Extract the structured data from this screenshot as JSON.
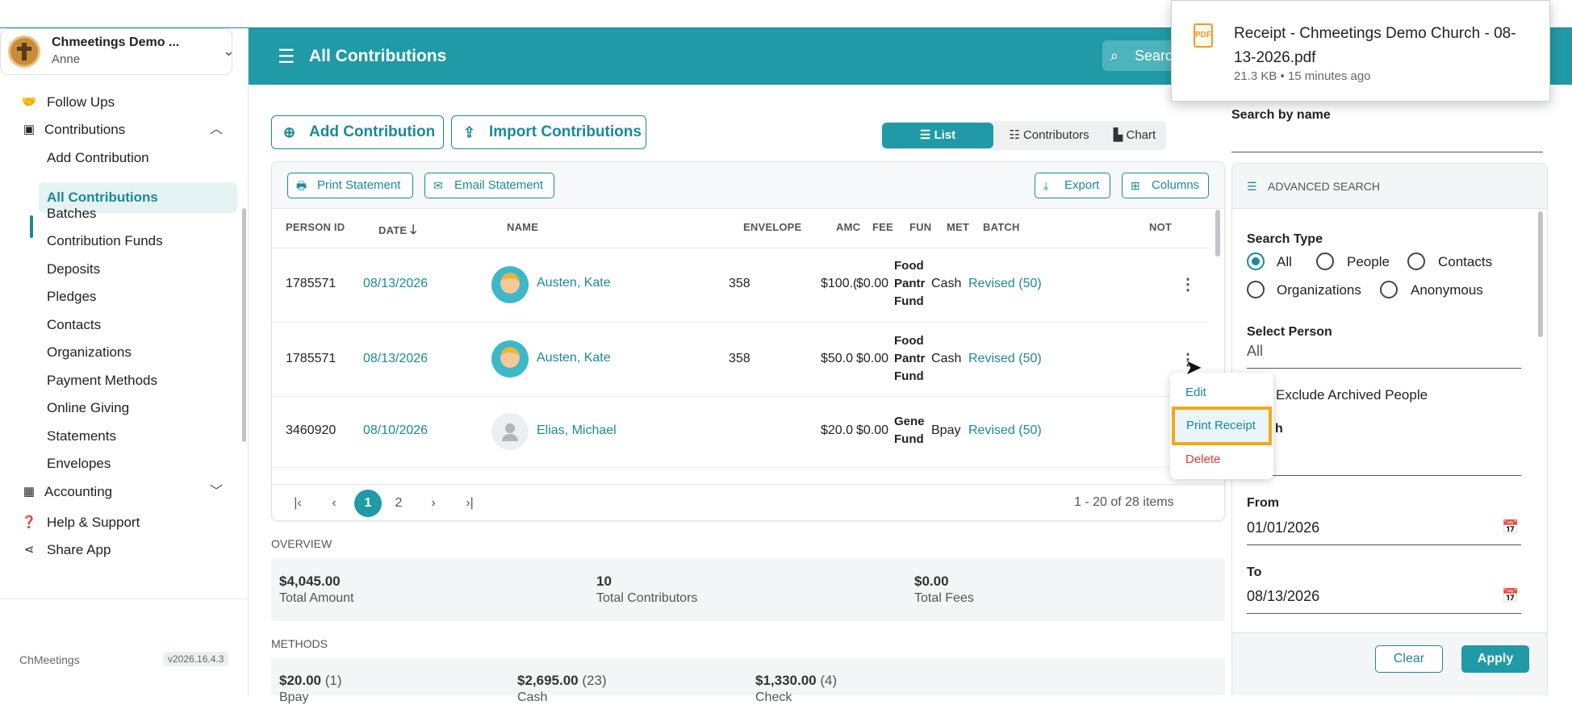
{
  "download": {
    "filename": "Receipt - Chmeetings Demo Church - 08-13-2026.pdf",
    "meta": "21.3 KB • 15 minutes ago"
  },
  "sidebar": {
    "church_name": "Chmeetings Demo ...",
    "user": "Anne",
    "items": [
      {
        "label": "Follow Ups",
        "icon": "handshake-icon"
      },
      {
        "label": "Contributions",
        "icon": "money-icon"
      },
      {
        "label": "Add Contribution"
      },
      {
        "label": "All Contributions"
      },
      {
        "label": "Batches"
      },
      {
        "label": "Contribution Funds"
      },
      {
        "label": "Deposits"
      },
      {
        "label": "Pledges"
      },
      {
        "label": "Contacts"
      },
      {
        "label": "Organizations"
      },
      {
        "label": "Payment Methods"
      },
      {
        "label": "Online Giving"
      },
      {
        "label": "Statements"
      },
      {
        "label": "Envelopes"
      },
      {
        "label": "Accounting",
        "icon": "grid-icon"
      }
    ],
    "help": "Help & Support",
    "share": "Share App",
    "brand": "ChMeetings",
    "version": "v2026.16.4.3"
  },
  "header": {
    "title": "All Contributions",
    "search_placeholder": "Searc"
  },
  "toolbar": {
    "add": "Add Contribution",
    "import": "Import Contributions",
    "views": [
      "List",
      "Contributors",
      "Chart"
    ],
    "print_statement": "Print Statement",
    "email_statement": "Email Statement",
    "export": "Export",
    "columns": "Columns"
  },
  "table": {
    "headers": [
      "PERSON ID",
      "DATE",
      "NAME",
      "ENVELOPE",
      "AMC",
      "FEE",
      "FUN",
      "MET",
      "BATCH",
      "NOT"
    ],
    "rows": [
      {
        "id": "1785571",
        "date": "08/13/2026",
        "name": "Austen, Kate",
        "envelope": "358",
        "amount": "$100.(",
        "fee": "$0.00",
        "fund1": "Food",
        "fund2": "Pantr",
        "fund3": "Fund",
        "method": "Cash",
        "batch": "Revised (50)"
      },
      {
        "id": "1785571",
        "date": "08/13/2026",
        "name": "Austen, Kate",
        "envelope": "358",
        "amount": "$50.0",
        "fee": "$0.00",
        "fund1": "Food",
        "fund2": "Pantr",
        "fund3": "Fund",
        "method": "Cash",
        "batch": "Revised (50)"
      },
      {
        "id": "3460920",
        "date": "08/10/2026",
        "name": "Elias, Michael",
        "envelope": "",
        "amount": "$20.0",
        "fee": "$0.00",
        "fund1": "Gene",
        "fund2": "Fund",
        "fund3": "",
        "method": "Bpay",
        "batch": "Revised (50)"
      }
    ]
  },
  "pager": {
    "pages": [
      "1",
      "2"
    ],
    "info": "1 - 20 of 28 items"
  },
  "row_menu": {
    "edit": "Edit",
    "print": "Print Receipt",
    "delete": "Delete"
  },
  "overview": {
    "label": "OVERVIEW",
    "stats": [
      {
        "value": "$4,045.00",
        "label": "Total Amount"
      },
      {
        "value": "10",
        "label": "Total Contributors"
      },
      {
        "value": "$0.00",
        "label": "Total Fees"
      }
    ]
  },
  "methods": {
    "label": "METHODS",
    "items": [
      {
        "value": "$20.00",
        "count": "(1)",
        "label": "Bpay"
      },
      {
        "value": "$2,695.00",
        "count": "(23)",
        "label": "Cash"
      },
      {
        "value": "$1,330.00",
        "count": "(4)",
        "label": "Check"
      }
    ]
  },
  "right_panel": {
    "search_label": "Search by name",
    "advanced": "ADVANCED SEARCH",
    "search_type_label": "Search Type",
    "types": [
      "All",
      "People",
      "Contacts",
      "Organizations",
      "Anonymous"
    ],
    "selected_type": "All",
    "select_person_label": "Select Person",
    "select_person_value": "All",
    "exclude_archived": "Exclude Archived People",
    "hidden_label": "h",
    "from_label": "From",
    "from_value": "01/01/2026",
    "to_label": "To",
    "to_value": "08/13/2026",
    "clear": "Clear",
    "apply": "Apply"
  },
  "colors": {
    "accent": "#1f9aa6",
    "highlight": "#f2a81d",
    "delete": "#e53935"
  }
}
